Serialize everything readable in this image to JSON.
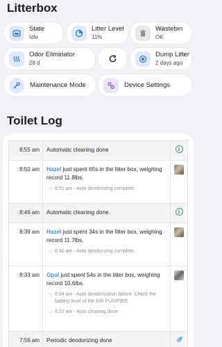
{
  "sections": {
    "litterbox_title": "Litterbox",
    "log_title": "Toilet Log"
  },
  "controls": {
    "state": {
      "label": "State",
      "value": "Idle",
      "icon": "litterbox-icon"
    },
    "litter_level": {
      "label": "Litter Level",
      "value": "11%",
      "icon": "circle-gauge-icon"
    },
    "wastebin": {
      "label": "Wastebin",
      "value": "OK",
      "icon": "trash-icon"
    },
    "odor_eliminator": {
      "label": "Odor Eliminator",
      "value": "28 d",
      "icon": "odor-waves-icon"
    },
    "refresh": {
      "icon": "refresh-icon"
    },
    "dump_litter": {
      "label": "Dump Litter",
      "value": "2 days ago",
      "icon": "dump-icon"
    },
    "maintenance_mode": {
      "label": "Maintenance Mode",
      "icon": "wrench-icon"
    },
    "device_settings": {
      "label": "Device Settings",
      "icon": "gear-icon"
    }
  },
  "log": [
    {
      "time": "8:55 am",
      "text": "Automatic cleaning done",
      "icon": "info-icon",
      "shaded": true
    },
    {
      "time": "8:50 am",
      "cat": "Hazel",
      "text": " just spent 65s in the litter box, weighing record 11.8lbs.",
      "subs": [
        "8:51 am - Auto deodorizing complete."
      ],
      "icon": "cat-photo"
    },
    {
      "time": "8:46 am",
      "text": "Automatic cleaning done",
      "icon": "info-icon",
      "shaded": true
    },
    {
      "time": "8:39 am",
      "cat": "Hazel",
      "text": " just spent 34s in the litter box, weighing record 11.7lbs.",
      "subs": [
        "8:40 am - Auto deodorizing complete."
      ],
      "icon": "cat-photo"
    },
    {
      "time": "8:33 am",
      "cat": "Opal",
      "text": " just spent 54s in the litter box, weighing record 10.6lbs.",
      "subs": [
        "8:34 am - Auto deodorization failure. Check the battery level of the AIR PURIFIER.",
        "8:37 am - Auto cleaning done"
      ],
      "icon": "cat-photo"
    },
    {
      "time": "7:56 am",
      "text": "Periodic deodorizing done",
      "icon": "leaf-icon",
      "shaded": true
    }
  ],
  "colors": {
    "accent_blue": "#3b7be0",
    "cat_name": "#4a8fd8",
    "info_green": "#3ea36b"
  }
}
